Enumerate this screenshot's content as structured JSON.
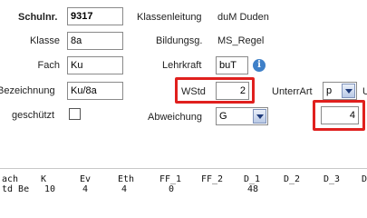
{
  "form": {
    "schulnr": {
      "label": "Schulnr.",
      "value": "9317"
    },
    "klassenleitung": {
      "label": "Klassenleitung",
      "value": "duM Duden"
    },
    "klasse": {
      "label": "Klasse",
      "value": "8a"
    },
    "bildungsg": {
      "label": "Bildungsg.",
      "value": "MS_Regel"
    },
    "fach": {
      "label": "Fach",
      "value": "Ku"
    },
    "lehrkraft": {
      "label": "Lehrkraft",
      "value": "buT"
    },
    "bezeichnung": {
      "label": "Bezeichnung",
      "value": "Ku/8a"
    },
    "wstd": {
      "label": "WStd",
      "value": "2"
    },
    "unterrart": {
      "label": "UnterrArt",
      "value": "p",
      "extra": "U"
    },
    "geschuetzt": {
      "label": "geschützt",
      "checked": false
    },
    "abweichung": {
      "label": "Abweichung",
      "value": "G",
      "number": "4"
    }
  },
  "grid": {
    "headers": [
      "ach",
      "K",
      "Ev",
      "Eth",
      "FF_1",
      "FF_2",
      "D_1",
      "D_2",
      "D_3",
      "D"
    ],
    "row1": [
      "td Be",
      "10",
      "4",
      "4",
      "0",
      "",
      "48",
      "",
      "",
      ""
    ],
    "row2": [
      "",
      "",
      "",
      "",
      "",
      "",
      "",
      "",
      "",
      ""
    ]
  },
  "colors": {
    "highlight": "#e0201e",
    "info": "#3f80c8"
  }
}
